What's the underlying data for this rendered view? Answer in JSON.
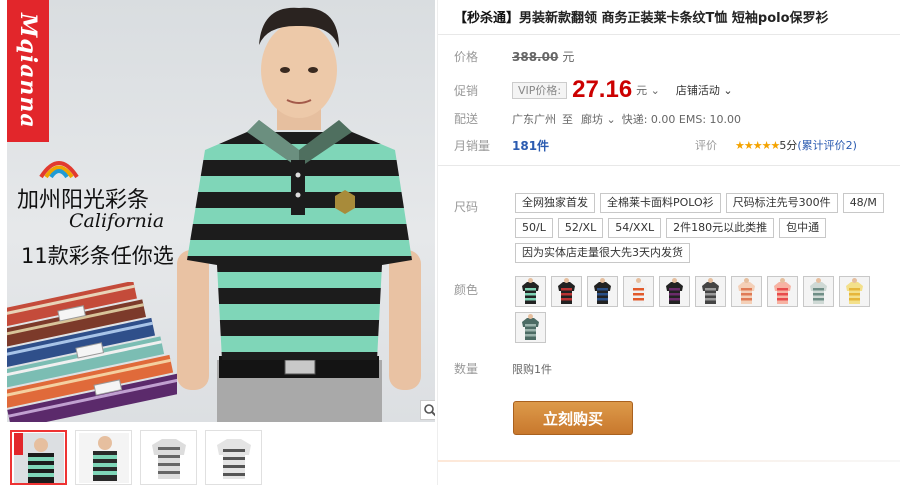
{
  "gallery": {
    "brand": "Mqianna",
    "promo_cn": "加州阳光彩条",
    "promo_en": "California",
    "promo_sub": "11款彩条任你选",
    "thumb_count": 4
  },
  "product": {
    "title_tag": "【秒杀通】",
    "title": "男装新款翻领 商务正装莱卡条纹T恤 短袖polo保罗衫"
  },
  "price": {
    "label": "价格",
    "original": "388.00",
    "unit": "元"
  },
  "promo": {
    "label": "促销",
    "vip": "VIP价格:",
    "sale_price": "27.16",
    "unit": "元",
    "store_activity": "店铺活动"
  },
  "delivery": {
    "label": "配送",
    "from": "广东广州",
    "to_word": "至",
    "to": "廊坊",
    "detail": "快递: 0.00 EMS: 10.00"
  },
  "monthly": {
    "label": "月销量",
    "count": "181件",
    "review_label": "评价",
    "stars": "★★★★★",
    "score": "5分",
    "review_link": "(累计评价2)"
  },
  "size": {
    "label": "尺码",
    "options": [
      "全网独家首发",
      "全棉莱卡面料POLO衫",
      "尺码标注先号300件",
      "48/M",
      "50/L",
      "52/XL",
      "54/XXL",
      "2件180元以此类推",
      "包中通",
      "因为实体店走量很大先3天内发货"
    ]
  },
  "color": {
    "label": "颜色",
    "swatches": [
      {
        "stripe": "#7fd3b5",
        "base": "#222"
      },
      {
        "stripe": "#b33",
        "base": "#222"
      },
      {
        "stripe": "#2a4f86",
        "base": "#222"
      },
      {
        "stripe": "#e25a2b",
        "base": "#f0f0f0"
      },
      {
        "stripe": "#6b2b6b",
        "base": "#222"
      },
      {
        "stripe": "#9a9a9a",
        "base": "#444"
      },
      {
        "stripe": "#e07b56",
        "base": "#f4d0b8"
      },
      {
        "stripe": "#e84c4c",
        "base": "#f7b3a3"
      },
      {
        "stripe": "#6f8e86",
        "base": "#cfd9d5"
      },
      {
        "stripe": "#e6b63a",
        "base": "#f3e08b"
      },
      {
        "stripe": "#9bb3ac",
        "base": "#4c6b64"
      }
    ]
  },
  "qty": {
    "label": "数量",
    "note": "限购1件"
  },
  "buy": {
    "label": "立刻购买"
  }
}
